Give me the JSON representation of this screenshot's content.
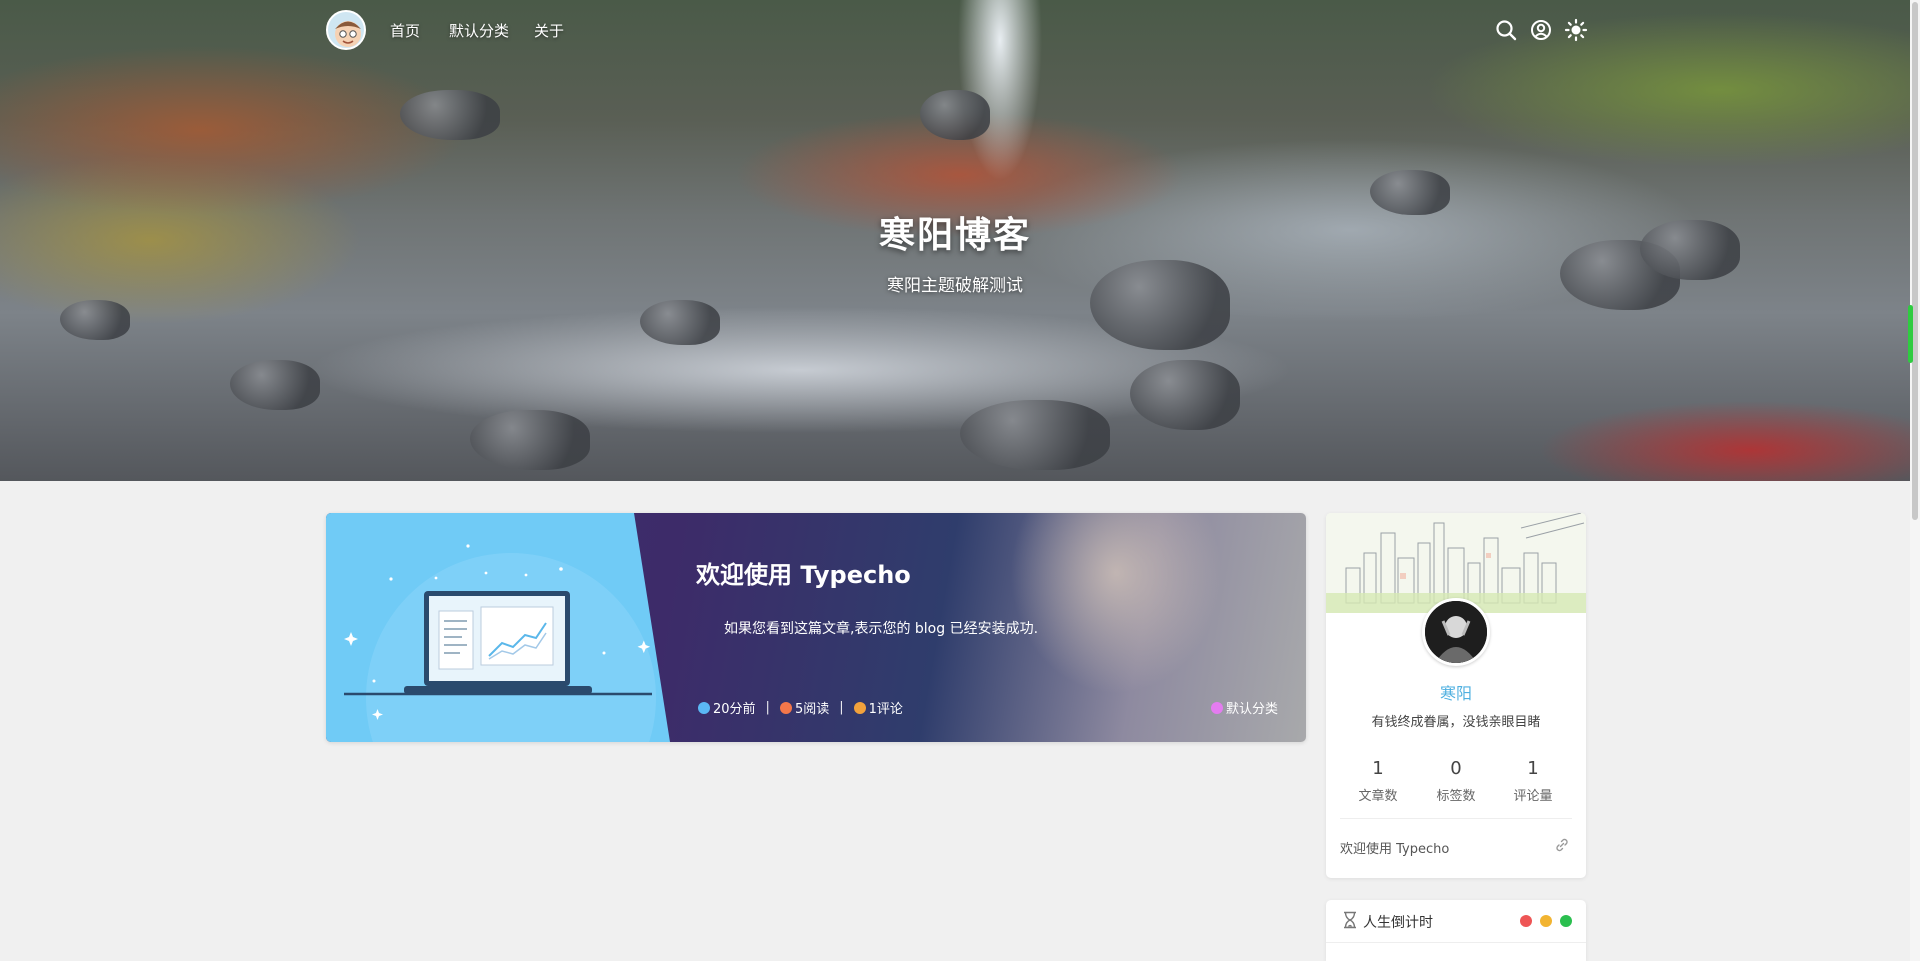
{
  "nav": {
    "links": [
      "首页",
      "默认分类",
      "关于"
    ],
    "icons": [
      "search-icon",
      "user-icon",
      "theme-sun-icon"
    ]
  },
  "hero": {
    "title": "寒阳博客",
    "subtitle": "寒阳主题破解测试"
  },
  "post": {
    "title": "欢迎使用 Typecho",
    "excerpt": "如果您看到这篇文章,表示您的 blog 已经安装成功.",
    "meta": {
      "time": "20分前",
      "views": "5阅读",
      "comments": "1评论",
      "separator": "|"
    },
    "category": "默认分类"
  },
  "profile": {
    "name": "寒阳",
    "motto": "有钱终成眷属，没钱亲眼目睹",
    "stats": [
      {
        "value": "1",
        "label": "文章数"
      },
      {
        "value": "0",
        "label": "标签数"
      },
      {
        "value": "1",
        "label": "评论量"
      }
    ],
    "recent_link": "欢迎使用 Typecho"
  },
  "countdown": {
    "title": "人生倒计时"
  },
  "colors": {
    "accent": "#4fb0e0",
    "thumb_bg": "#70cbf6",
    "dot_red": "#ee5555",
    "dot_yellow": "#f2b431",
    "dot_green": "#2bbf4f",
    "meta_time": "#5bb8f5",
    "meta_views": "#f4774a",
    "meta_comments": "#f2a23c",
    "meta_category": "#e47cf0"
  }
}
